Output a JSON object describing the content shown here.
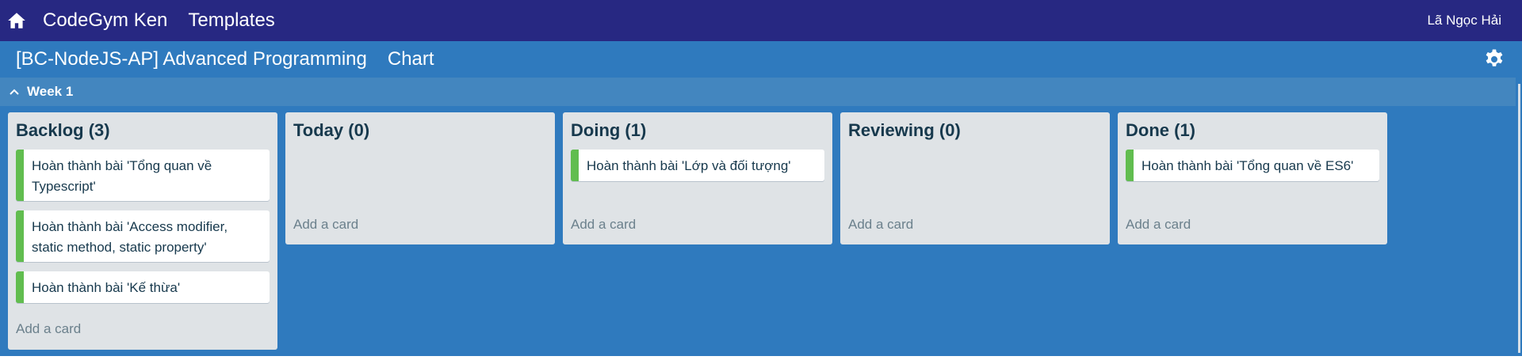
{
  "topbar": {
    "brand": "CodeGym Ken",
    "templates": "Templates",
    "user": "Lã Ngọc Hải"
  },
  "board": {
    "title": "[BC-NodeJS-AP] Advanced Programming",
    "chart_link": "Chart"
  },
  "week": {
    "label": "Week 1"
  },
  "lists": [
    {
      "title": "Backlog (3)",
      "cards": [
        "Hoàn thành bài 'Tổng quan về Typescript'",
        "Hoàn thành bài 'Access modifier, static method, static property'",
        "Hoàn thành bài 'Kế thừa'"
      ],
      "add_card": "Add a card"
    },
    {
      "title": "Today (0)",
      "cards": [],
      "add_card": "Add a card"
    },
    {
      "title": "Doing (1)",
      "cards": [
        "Hoàn thành bài 'Lớp và đối tượng'"
      ],
      "add_card": "Add a card"
    },
    {
      "title": "Reviewing (0)",
      "cards": [],
      "add_card": "Add a card"
    },
    {
      "title": "Done (1)",
      "cards": [
        "Hoàn thành bài 'Tổng quan về ES6'"
      ],
      "add_card": "Add a card"
    }
  ],
  "colors": {
    "topbar": "#272882",
    "board": "#2f7abe",
    "weekbar": "#4386bf",
    "list": "#dfe3e6",
    "card_label": "#61bd4f"
  },
  "icons": {
    "home": "home-icon",
    "settings": "gear-icon",
    "collapse": "chevron-up-icon"
  }
}
